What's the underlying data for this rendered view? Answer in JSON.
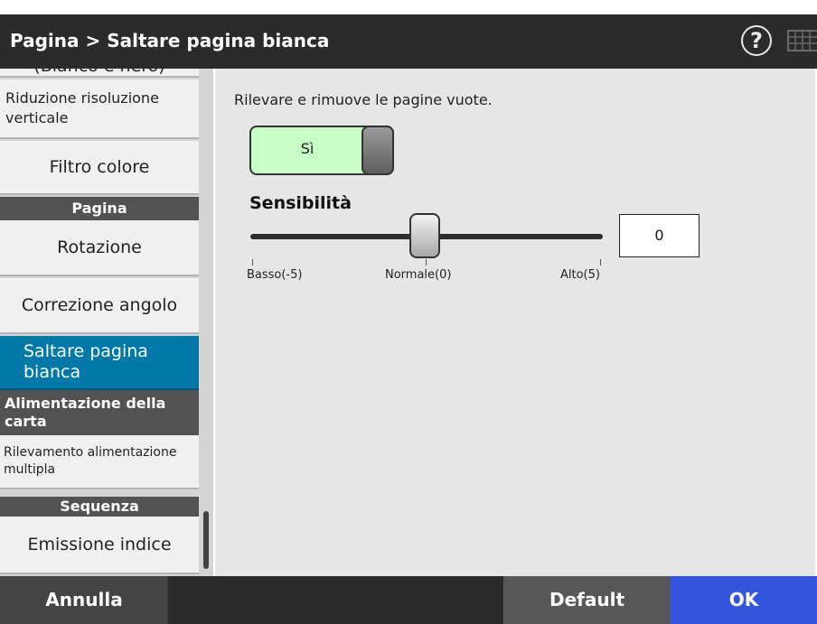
{
  "header": {
    "title": "Pagina > Saltare pagina bianca",
    "help_label": "?",
    "help_icon": "help-icon",
    "keyboard_icon": "keyboard-icon"
  },
  "sidebar": {
    "items": [
      {
        "label": "(Bianco e nero)",
        "type": "item"
      },
      {
        "label": "Riduzione risoluzione verticale",
        "type": "item"
      },
      {
        "label": "Filtro colore",
        "type": "item"
      },
      {
        "label": "Pagina",
        "type": "header"
      },
      {
        "label": "Rotazione",
        "type": "item"
      },
      {
        "label": "Correzione angolo",
        "type": "item"
      },
      {
        "label": "Saltare pagina bianca",
        "type": "item",
        "selected": true
      },
      {
        "label": "Alimentazione della carta",
        "type": "header"
      },
      {
        "label": "Rilevamento alimentazione multipla",
        "type": "item"
      },
      {
        "label": "Sequenza",
        "type": "header"
      },
      {
        "label": "Emissione indice",
        "type": "item"
      }
    ]
  },
  "content": {
    "description": "Rilevare e rimuove le pagine vuote.",
    "toggle": {
      "label": "Sì",
      "on": true,
      "color_on": "#c7ffc7"
    },
    "sensitivity": {
      "title": "Sensibilità",
      "min": -5,
      "max": 5,
      "value": 0,
      "value_display": "0",
      "ticks": [
        {
          "label": "Basso(-5)"
        },
        {
          "label": "Normale(0)"
        },
        {
          "label": "Alto(5)"
        }
      ]
    }
  },
  "footer": {
    "cancel": "Annulla",
    "default": "Default",
    "ok": "OK"
  },
  "colors": {
    "topbar": "#2b2b2b",
    "selected_item": "#0078a8",
    "ok_button": "#3355dd",
    "default_button": "#575757",
    "section_header": "#525252"
  }
}
